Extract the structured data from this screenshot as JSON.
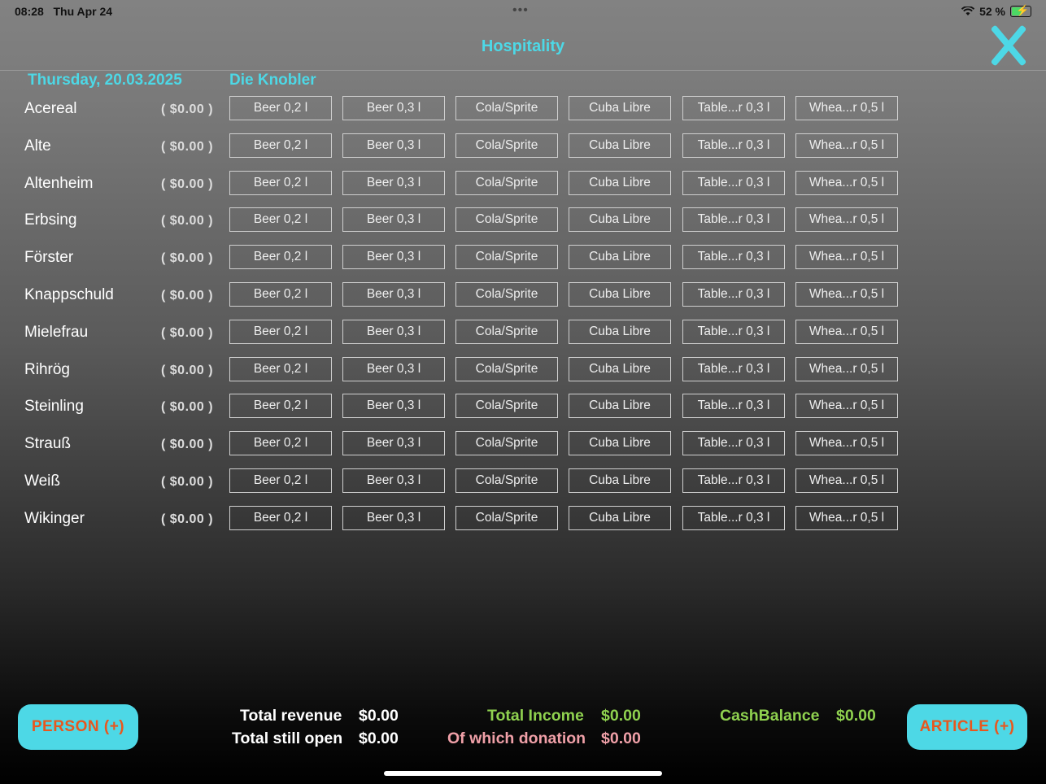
{
  "status_bar": {
    "time": "08:28",
    "date": "Thu Apr 24",
    "battery": "52 %"
  },
  "header": {
    "title": "Hospitality"
  },
  "subheader": {
    "date": "Thursday, 20.03.2025",
    "group": "Die Knobler"
  },
  "articles": [
    "Beer 0,2 l",
    "Beer 0,3 l",
    "Cola/Sprite",
    "Cuba Libre",
    "Table...r 0,3 l",
    "Whea...r 0,5 l"
  ],
  "persons": [
    {
      "name": "Acereal",
      "amount": "( $0.00 )"
    },
    {
      "name": "Alte",
      "amount": "( $0.00 )"
    },
    {
      "name": "Altenheim",
      "amount": "( $0.00 )"
    },
    {
      "name": "Erbsing",
      "amount": "( $0.00 )"
    },
    {
      "name": "Förster",
      "amount": "( $0.00 )"
    },
    {
      "name": "Knappschuld",
      "amount": "( $0.00 )"
    },
    {
      "name": "Mielefrau",
      "amount": "( $0.00 )"
    },
    {
      "name": "Rihrög",
      "amount": "( $0.00 )"
    },
    {
      "name": "Steinling",
      "amount": "( $0.00 )"
    },
    {
      "name": "Strauß",
      "amount": "( $0.00 )"
    },
    {
      "name": "Weiß",
      "amount": "( $0.00 )"
    },
    {
      "name": "Wikinger",
      "amount": "( $0.00 )"
    }
  ],
  "footer": {
    "person_button": "PERSON (+)",
    "article_button": "ARTICLE (+)",
    "total_revenue_label": "Total revenue",
    "total_revenue_value": "$0.00",
    "total_open_label": "Total still open",
    "total_open_value": "$0.00",
    "total_income_label": "Total Income",
    "total_income_value": "$0.00",
    "donation_label": "Of which donation",
    "donation_value": "$0.00",
    "cash_balance_label": "CashBalance",
    "cash_balance_value": "$0.00"
  },
  "colors": {
    "accent": "#4dd8e6",
    "button_text": "#e8571e",
    "income": "#8fd14f",
    "donation": "#f0a0a8"
  }
}
